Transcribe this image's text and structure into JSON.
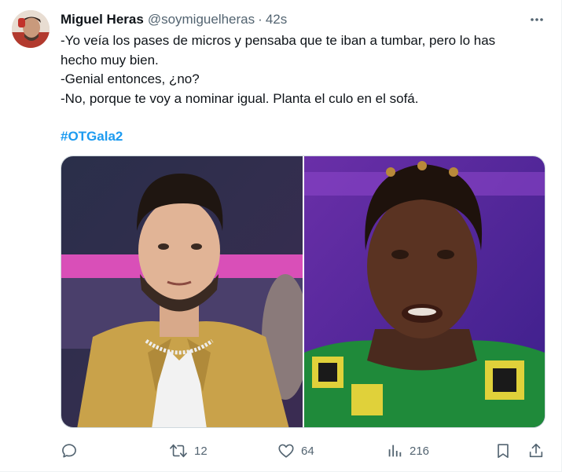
{
  "tweet": {
    "author": {
      "display_name": "Miguel Heras",
      "handle": "@soymiguelheras",
      "separator": "·",
      "time": "42s"
    },
    "text_lines": [
      "-Yo veía los pases de micros y pensaba que te iban a tumbar, pero lo has",
      "hecho muy bien.",
      "-Genial entonces, ¿no?",
      "-No, porque te voy a nominar igual. Planta el culo en el sofá."
    ],
    "hashtag": "#OTGala2",
    "actions": {
      "reply_count": "",
      "retweet_count": "12",
      "like_count": "64",
      "views_count": "216"
    },
    "icons": {
      "more": "more-dots-icon",
      "reply": "reply-icon",
      "retweet": "retweet-icon",
      "like": "heart-icon",
      "views": "views-chart-icon",
      "bookmark": "bookmark-icon",
      "share": "share-icon"
    },
    "colors": {
      "link": "#1d9bf0",
      "secondary_text": "#536471",
      "primary_text": "#0f1419",
      "border": "#cfd9de"
    }
  }
}
